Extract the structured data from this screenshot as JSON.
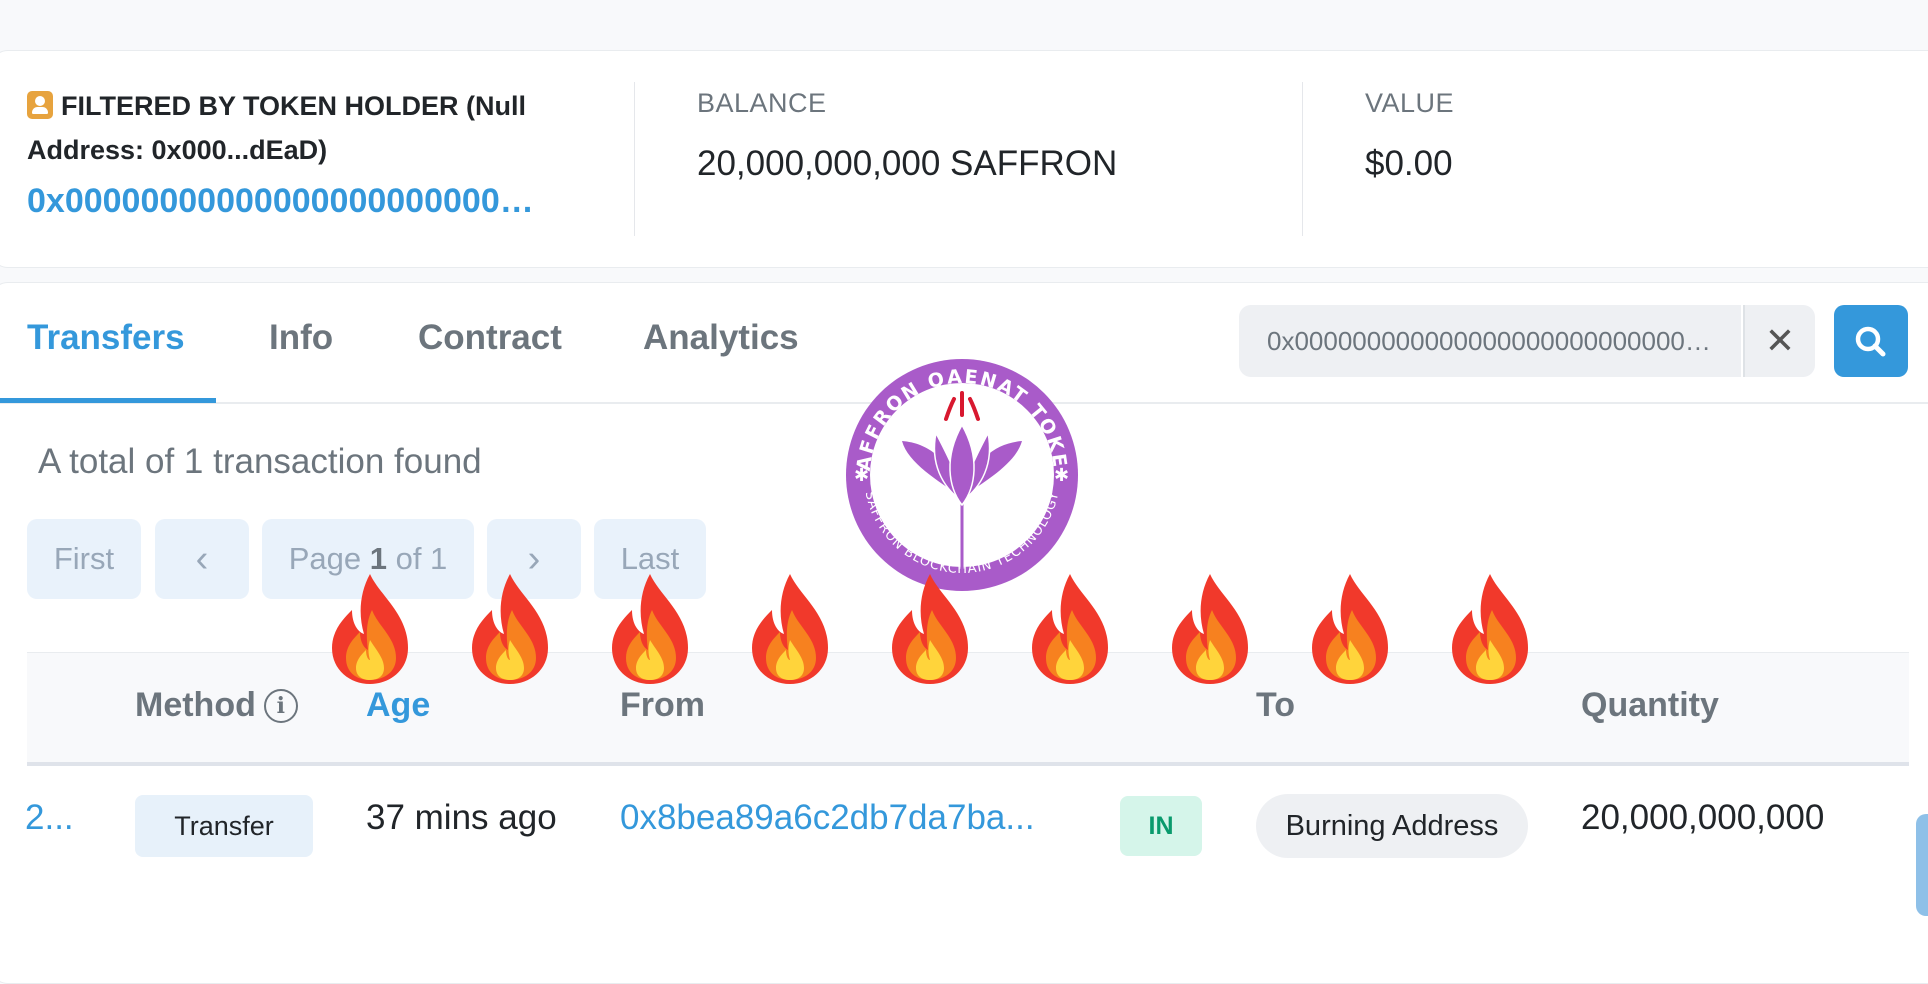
{
  "summary": {
    "filter_heading": "FILTERED BY TOKEN HOLDER (Null Address: 0x000...dEaD)",
    "holder_address": "0x000000000000000000000000000000000000dEaD",
    "balance_label": "BALANCE",
    "balance_value": "20,000,000,000 SAFFRON",
    "value_label": "VALUE",
    "value_amount": "$0.00"
  },
  "tabs": [
    {
      "label": "Transfers",
      "active": true
    },
    {
      "label": "Info",
      "active": false
    },
    {
      "label": "Contract",
      "active": false
    },
    {
      "label": "Analytics",
      "active": false
    }
  ],
  "search": {
    "value": "0x000000000000000000000000000000000000dEaD",
    "clear_icon": "close-icon",
    "button_icon": "search-icon"
  },
  "results": {
    "total_text": "A total of 1 transaction found"
  },
  "pager": {
    "first": "First",
    "prev": "‹",
    "page_prefix": "Page ",
    "page_current": "1",
    "page_suffix": " of 1",
    "next": "›",
    "last": "Last"
  },
  "table": {
    "columns": [
      "Method",
      "Age",
      "From",
      "To",
      "Quantity"
    ],
    "rows": [
      {
        "txn_hash": "2...",
        "method": "Transfer",
        "age": "37 mins ago",
        "from": "0x8bea89a6c2db7da7ba...",
        "direction": "IN",
        "to": "Burning Address",
        "quantity": "20,000,000,000"
      }
    ]
  },
  "overlay": {
    "logo_ring_top": "SAFFRON QAENAT TOKEN",
    "logo_ring_bottom": "SAFFRON BLOCKCHAIN TECHNOLOGY",
    "flame_count": 9
  },
  "colors": {
    "accent": "#3498db",
    "logo_purple": "#a95bc9",
    "in_badge": "#0a9a6d"
  }
}
